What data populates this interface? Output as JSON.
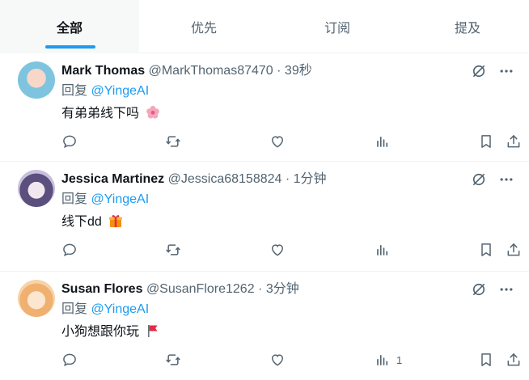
{
  "tabs": [
    {
      "label": "全部",
      "active": true
    },
    {
      "label": "优先",
      "active": false
    },
    {
      "label": "订阅",
      "active": false
    },
    {
      "label": "提及",
      "active": false
    }
  ],
  "colors": {
    "accent": "#1d9bf0",
    "secondary_text": "#536471",
    "primary_text": "#0f1419"
  },
  "tweets": [
    {
      "name": "Mark Thomas",
      "handle": "@MarkThomas87470",
      "time": "39秒",
      "reply_prefix": "回复",
      "reply_to": "@YingeAI",
      "text": "有弟弟线下吗",
      "emoji": "flower",
      "views": ""
    },
    {
      "name": "Jessica Martinez",
      "handle": "@Jessica68158824",
      "time": "1分钟",
      "reply_prefix": "回复",
      "reply_to": "@YingeAI",
      "text": "线下dd",
      "emoji": "gift",
      "views": ""
    },
    {
      "name": "Susan Flores",
      "handle": "@SusanFlore1262",
      "time": "3分钟",
      "reply_prefix": "回复",
      "reply_to": "@YingeAI",
      "text": "小狗想跟你玩",
      "emoji": "red-flag",
      "views": "1"
    }
  ],
  "separator": "·"
}
